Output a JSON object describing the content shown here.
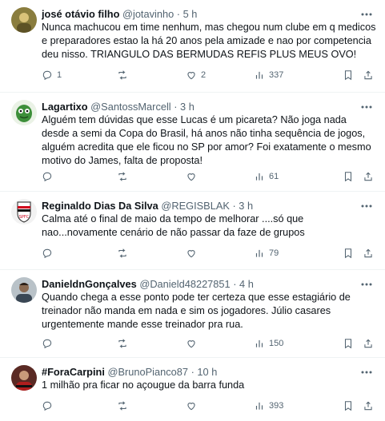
{
  "tweets": [
    {
      "name": "josé otávio filho",
      "handle": "@jotavinho",
      "dot": "·",
      "time": "5 h",
      "text": "Nunca machucou em time nenhum, mas chegou num clube em q medicos e preparadores estao la há 20 anos pela amizade e nao por competencia deu nisso. TRIANGULO DAS BERMUDAS REFIS PLUS MEUS OVO!",
      "replies": "1",
      "retweets": "",
      "likes": "2",
      "views": "337"
    },
    {
      "name": "Lagartixo",
      "handle": "@SantossMarcell",
      "dot": "·",
      "time": "3 h",
      "text": "Alguém tem dúvidas que esse Lucas é um picareta? Não joga nada desde a semi da Copa do Brasil, há anos não tinha sequência de jogos, alguém acredita que ele ficou no SP por amor? Foi exatamente o mesmo motivo do James, falta de proposta!",
      "replies": "",
      "retweets": "",
      "likes": "",
      "views": "61"
    },
    {
      "name": "Reginaldo Dias Da Silva",
      "handle": "@REGISBLAK",
      "dot": "·",
      "time": "3 h",
      "text": "Calma até o final de maio da tempo de melhorar ....só que nao...novamente cenário de não passar da faze de grupos",
      "replies": "",
      "retweets": "",
      "likes": "",
      "views": "79"
    },
    {
      "name": "DanieldnGonçalves",
      "handle": "@Danield48227851",
      "dot": "·",
      "time": "4 h",
      "text": "Quando chega a esse ponto pode ter certeza que esse estagiário de treinador não manda em nada e sim os jogadores. Júlio casares urgentemente mande esse treinador pra rua.",
      "replies": "",
      "retweets": "",
      "likes": "",
      "views": "150"
    },
    {
      "name": "#ForaCarpini",
      "handle": "@BrunoPianco87",
      "dot": "·",
      "time": "10 h",
      "text": "1 milhão pra ficar no açougue da barra funda",
      "replies": "",
      "retweets": "",
      "likes": "",
      "views": "393"
    }
  ],
  "icons": {
    "reply": "speech-bubble-icon",
    "retweet": "retweet-arrows-icon",
    "like": "heart-icon",
    "views": "bar-chart-icon",
    "bookmark": "bookmark-icon",
    "share": "share-upload-icon",
    "more": "ellipsis-icon"
  },
  "colors": {
    "text": "#0f1419",
    "secondary": "#536471",
    "divider": "#eff3f4"
  }
}
